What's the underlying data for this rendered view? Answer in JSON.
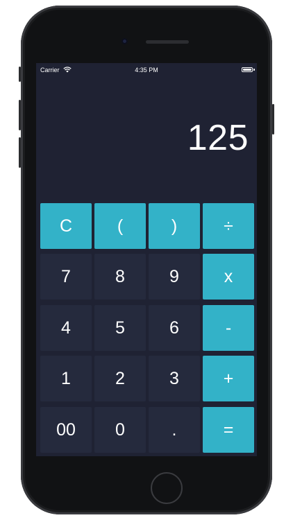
{
  "status": {
    "carrier": "Carrier",
    "time": "4:35 PM"
  },
  "display": {
    "value": "125"
  },
  "keys": {
    "clear": "C",
    "lparen": "(",
    "rparen": ")",
    "divide": "÷",
    "seven": "7",
    "eight": "8",
    "nine": "9",
    "multiply": "x",
    "four": "4",
    "five": "5",
    "six": "6",
    "minus": "-",
    "one": "1",
    "two": "2",
    "three": "3",
    "plus": "+",
    "double_zero": "00",
    "zero": "0",
    "dot": ".",
    "equals": "="
  },
  "colors": {
    "accent": "#33b2c8",
    "key_bg": "#252a3d",
    "screen_bg": "#1f2233"
  }
}
